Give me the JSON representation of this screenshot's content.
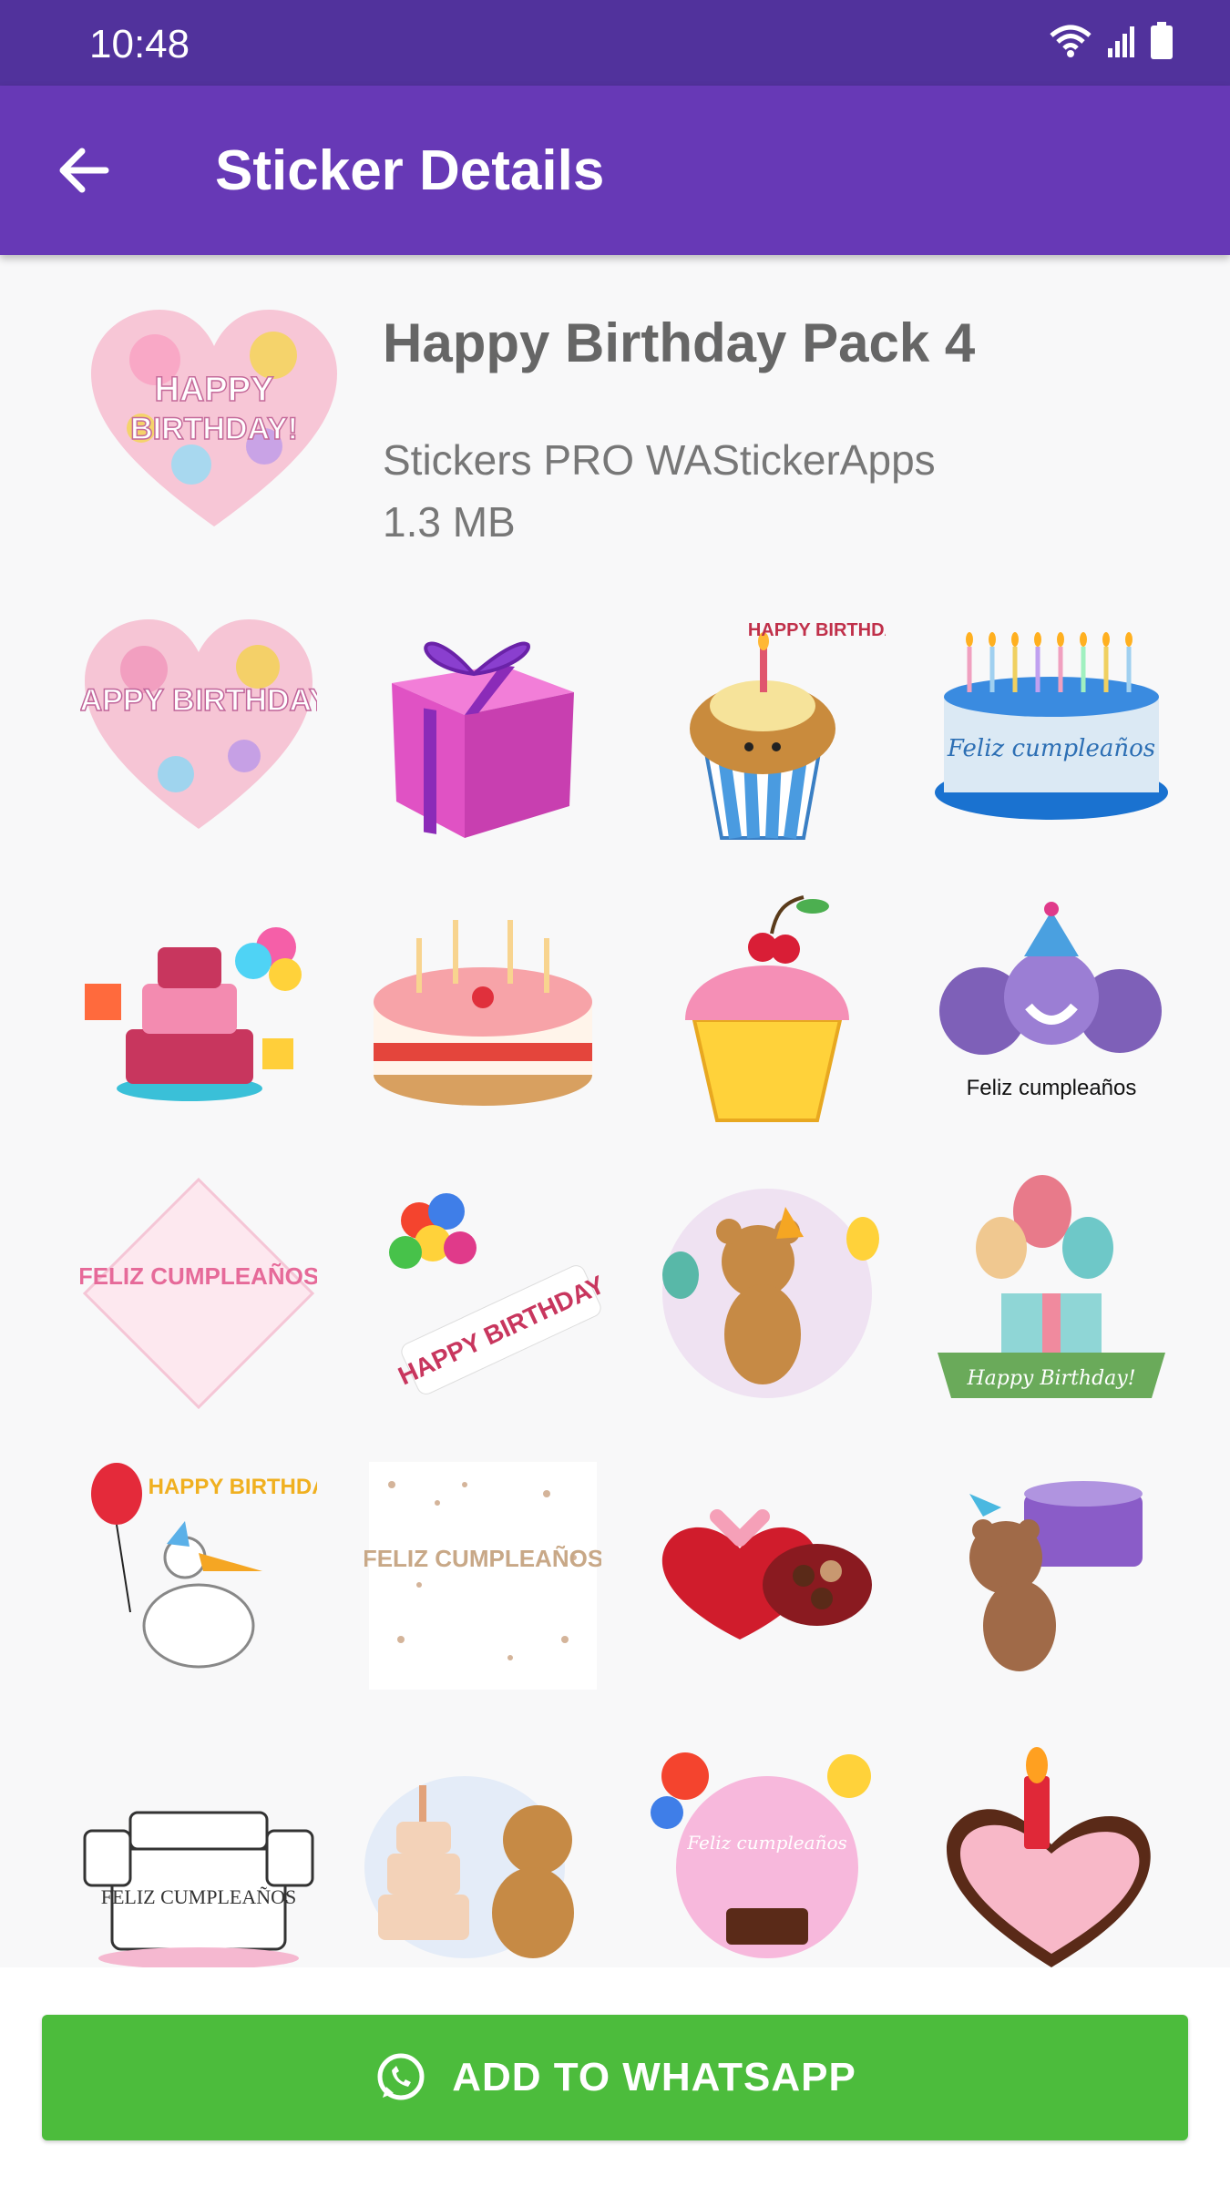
{
  "status": {
    "time": "10:48",
    "icons": [
      "wifi-icon",
      "signal-icon",
      "battery-icon"
    ]
  },
  "app_bar": {
    "title": "Sticker Details",
    "back_icon": "arrow-left-icon"
  },
  "pack": {
    "name": "Happy Birthday Pack 4",
    "publisher": "Stickers PRO WAStickerApps",
    "size": "1.3 MB"
  },
  "stickers": [
    {
      "name": "heart-happy-birthday",
      "text": "HAPPY BIRTHDAY!"
    },
    {
      "name": "gift-box",
      "text": ""
    },
    {
      "name": "cupcake-happy-birthday",
      "text": "HAPPY BIRTHDAY!"
    },
    {
      "name": "cake-feliz-cumpleanos",
      "text": "Feliz cumpleaños"
    },
    {
      "name": "party-cake",
      "text": ""
    },
    {
      "name": "strawberry-cake",
      "text": ""
    },
    {
      "name": "cherry-cupcake",
      "text": ""
    },
    {
      "name": "party-emojis",
      "text": "Feliz cumpleaños"
    },
    {
      "name": "pink-diamond-feliz",
      "text": "FELIZ CUMPLEAÑOS"
    },
    {
      "name": "balloons-happy-birthday",
      "text": "HAPPY BIRTHDAY"
    },
    {
      "name": "teddy-bear-party",
      "text": ""
    },
    {
      "name": "gift-balloons-ribbon",
      "text": "Happy Birthday!"
    },
    {
      "name": "pelican-happy-birthday",
      "text": "HAPPY BIRTHDAY"
    },
    {
      "name": "confetti-feliz",
      "text": "FELIZ CUMPLEAÑOS"
    },
    {
      "name": "heart-chocolate-box",
      "text": ""
    },
    {
      "name": "bear-with-cake",
      "text": ""
    },
    {
      "name": "cats-feliz-cake",
      "text": "FELIZ CUMPLEAÑOS"
    },
    {
      "name": "bear-layer-cake",
      "text": ""
    },
    {
      "name": "pink-circle-feliz",
      "text": "Feliz cumpleaños"
    },
    {
      "name": "heart-cake-candle",
      "text": ""
    }
  ],
  "add_button": {
    "label": "ADD TO WHATSAPP",
    "icon": "whatsapp-icon"
  },
  "colors": {
    "status_bar": "#51329c",
    "app_bar": "#6739b6",
    "button": "#4cbc3c"
  }
}
